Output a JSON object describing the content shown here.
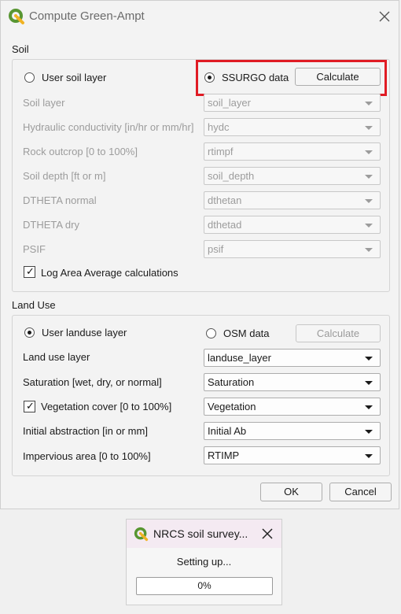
{
  "window": {
    "title": "Compute Green-Ampt"
  },
  "soil": {
    "section_label": "Soil",
    "user_soil_layer_label": "User soil layer",
    "user_soil_layer_selected": false,
    "ssurgo_label": "SSURGO data",
    "ssurgo_selected": true,
    "calculate_label": "Calculate",
    "fields": [
      {
        "label": "Soil layer",
        "value": "soil_layer"
      },
      {
        "label": "Hydraulic conductivity [in/hr or mm/hr]",
        "value": "hydc"
      },
      {
        "label": "Rock outcrop [0 to 100%]",
        "value": "rtimpf"
      },
      {
        "label": "Soil depth [ft or m]",
        "value": "soil_depth"
      },
      {
        "label": "DTHETA normal",
        "value": "dthetan"
      },
      {
        "label": "DTHETA dry",
        "value": "dthetad"
      },
      {
        "label": "PSIF",
        "value": "psif"
      }
    ],
    "log_checkbox_label": "Log Area Average calculations",
    "log_checked": true
  },
  "landuse": {
    "section_label": "Land Use",
    "user_layer_label": "User landuse layer",
    "user_layer_selected": true,
    "osm_label": "OSM data",
    "osm_selected": false,
    "calculate_label": "Calculate",
    "fields": [
      {
        "label": "Land use layer",
        "value": "landuse_layer"
      },
      {
        "label": "Saturation [wet, dry, or normal]",
        "value": "Saturation"
      },
      {
        "label": "Vegetation cover [0 to 100%]",
        "value": "Vegetation"
      },
      {
        "label": "Initial abstraction [in or mm]",
        "value": "Initial Ab"
      },
      {
        "label": "Impervious area [0 to 100%]",
        "value": "RTIMP"
      }
    ],
    "vegetation_checked": true
  },
  "buttons": {
    "ok": "OK",
    "cancel": "Cancel"
  },
  "progress_dialog": {
    "title": "NRCS soil survey...",
    "message": "Setting up...",
    "progress": 0,
    "progress_text": "0%"
  },
  "colors": {
    "highlight": "#e01b24",
    "qgis_green": "#589632",
    "qgis_yellow": "#f0b323"
  },
  "icons": [
    "qgis-logo-icon",
    "close-icon",
    "chevron-down-icon",
    "checkmark-icon"
  ]
}
